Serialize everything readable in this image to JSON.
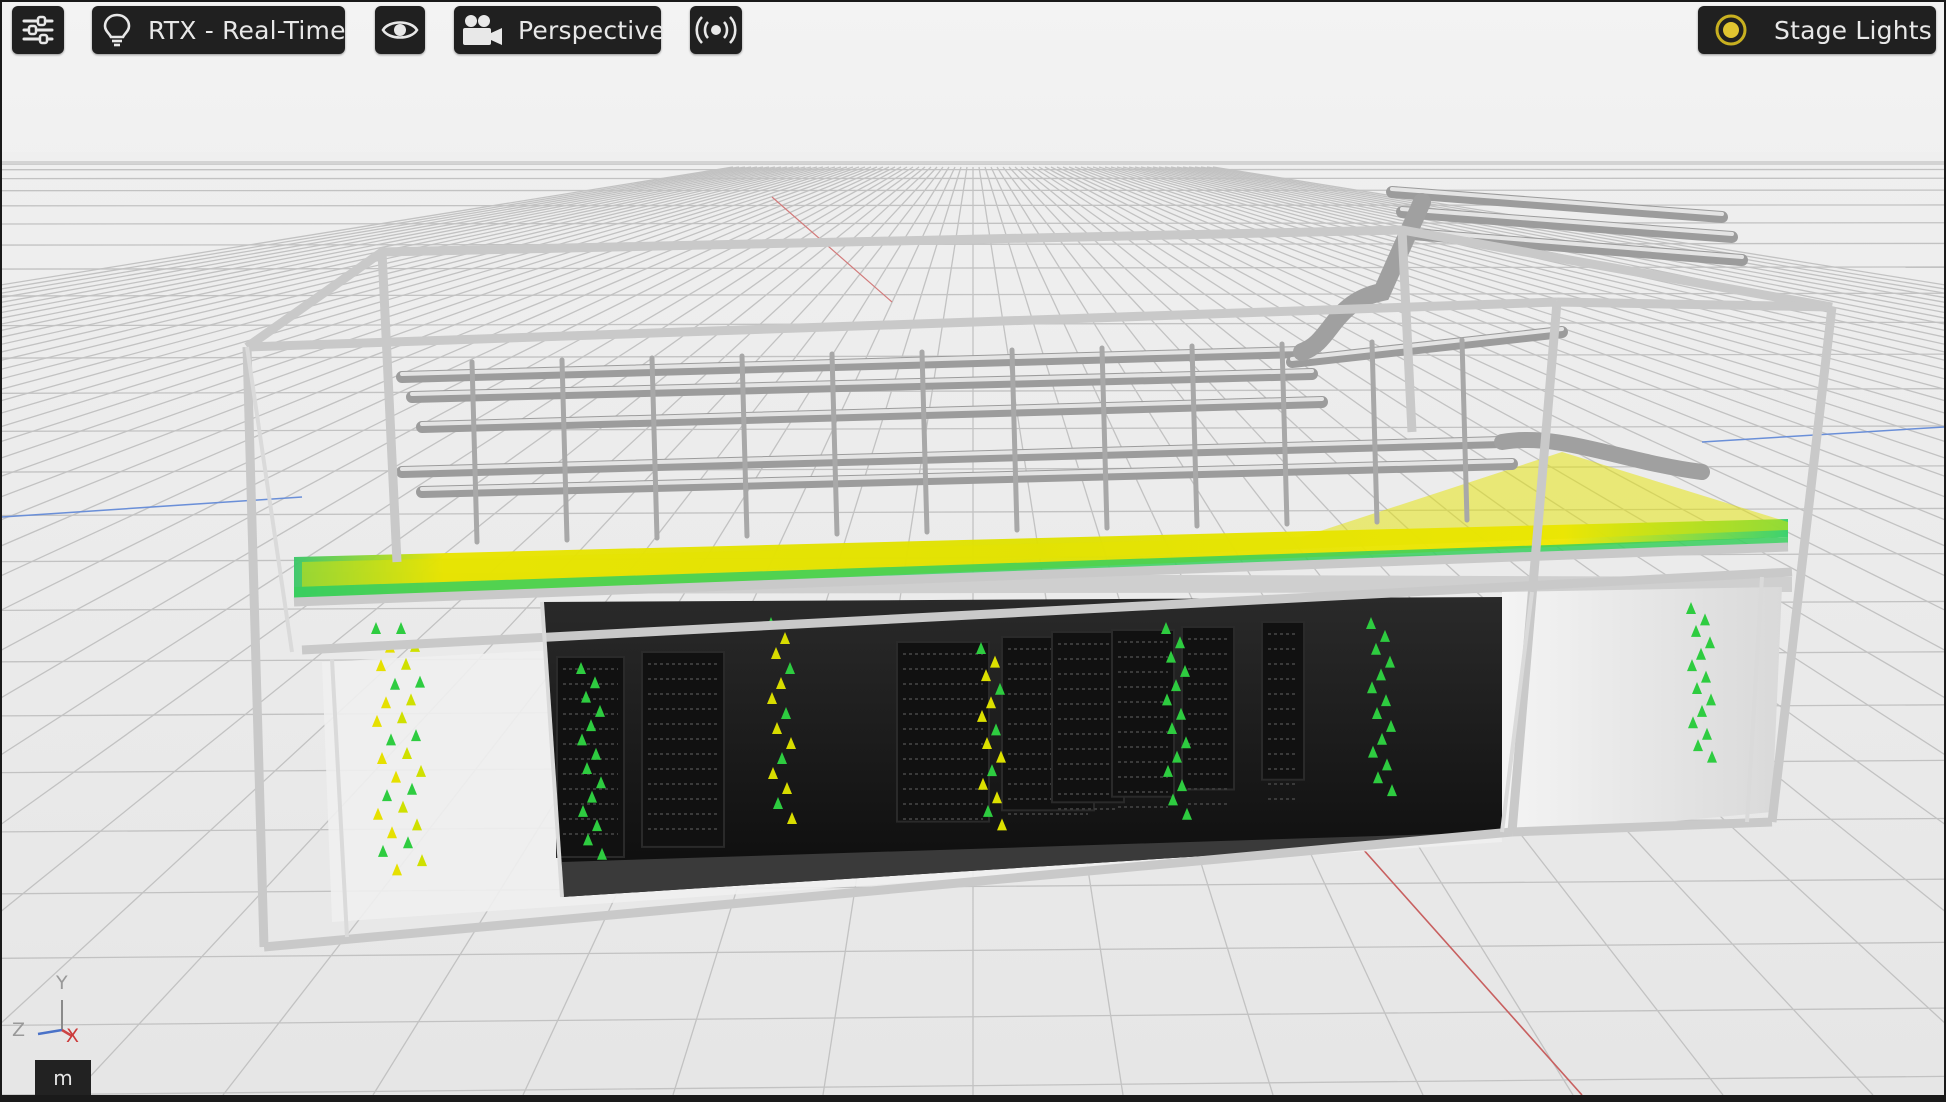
{
  "toolbar": {
    "settings_icon": "sliders-icon",
    "render_mode": {
      "icon": "lightbulb-icon",
      "label": "RTX - Real-Time"
    },
    "visibility_icon": "eye-icon",
    "camera": {
      "icon": "movie-camera-icon",
      "label": "Perspective"
    },
    "audio_icon": "broadcast-icon",
    "lighting": {
      "icon": "sun-icon",
      "label": "Stage Lights"
    }
  },
  "viewport": {
    "scene": "3D data center container model with cooling pipes, server racks and airflow vectors over a ground grid",
    "colors": {
      "grid_line": "#c4c4c4",
      "x_axis": "#d05050",
      "z_axis": "#4a7bd0",
      "heat_yellow": "#e8e000",
      "heat_green": "#2ecc40"
    }
  },
  "axis_gizmo": {
    "y_label": "Y",
    "z_label": "Z",
    "x_label": "X"
  },
  "units_badge": "m"
}
